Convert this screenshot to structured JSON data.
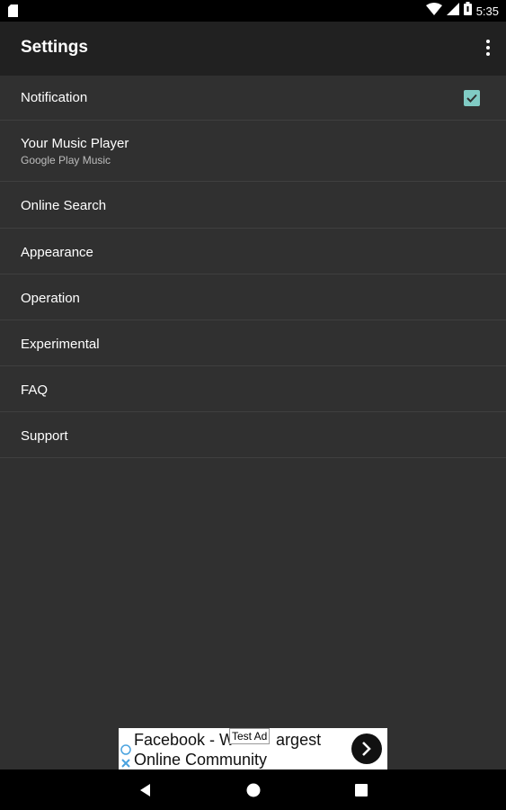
{
  "status_bar": {
    "time": "5:35"
  },
  "app_bar": {
    "title": "Settings"
  },
  "settings": [
    {
      "title": "Notification",
      "checked": true
    },
    {
      "title": "Your Music Player",
      "summary": "Google Play Music"
    },
    {
      "title": "Online Search"
    },
    {
      "title": "Appearance"
    },
    {
      "title": "Operation"
    },
    {
      "title": "Experimental"
    },
    {
      "title": "FAQ"
    },
    {
      "title": "Support"
    }
  ],
  "ad": {
    "line1": "Facebook - W",
    "line1_rest": "argest",
    "line2": "Online Community",
    "badge": "Test Ad"
  },
  "colors": {
    "accent": "#80cbc4",
    "app_bar": "#212121",
    "background": "#303030"
  }
}
